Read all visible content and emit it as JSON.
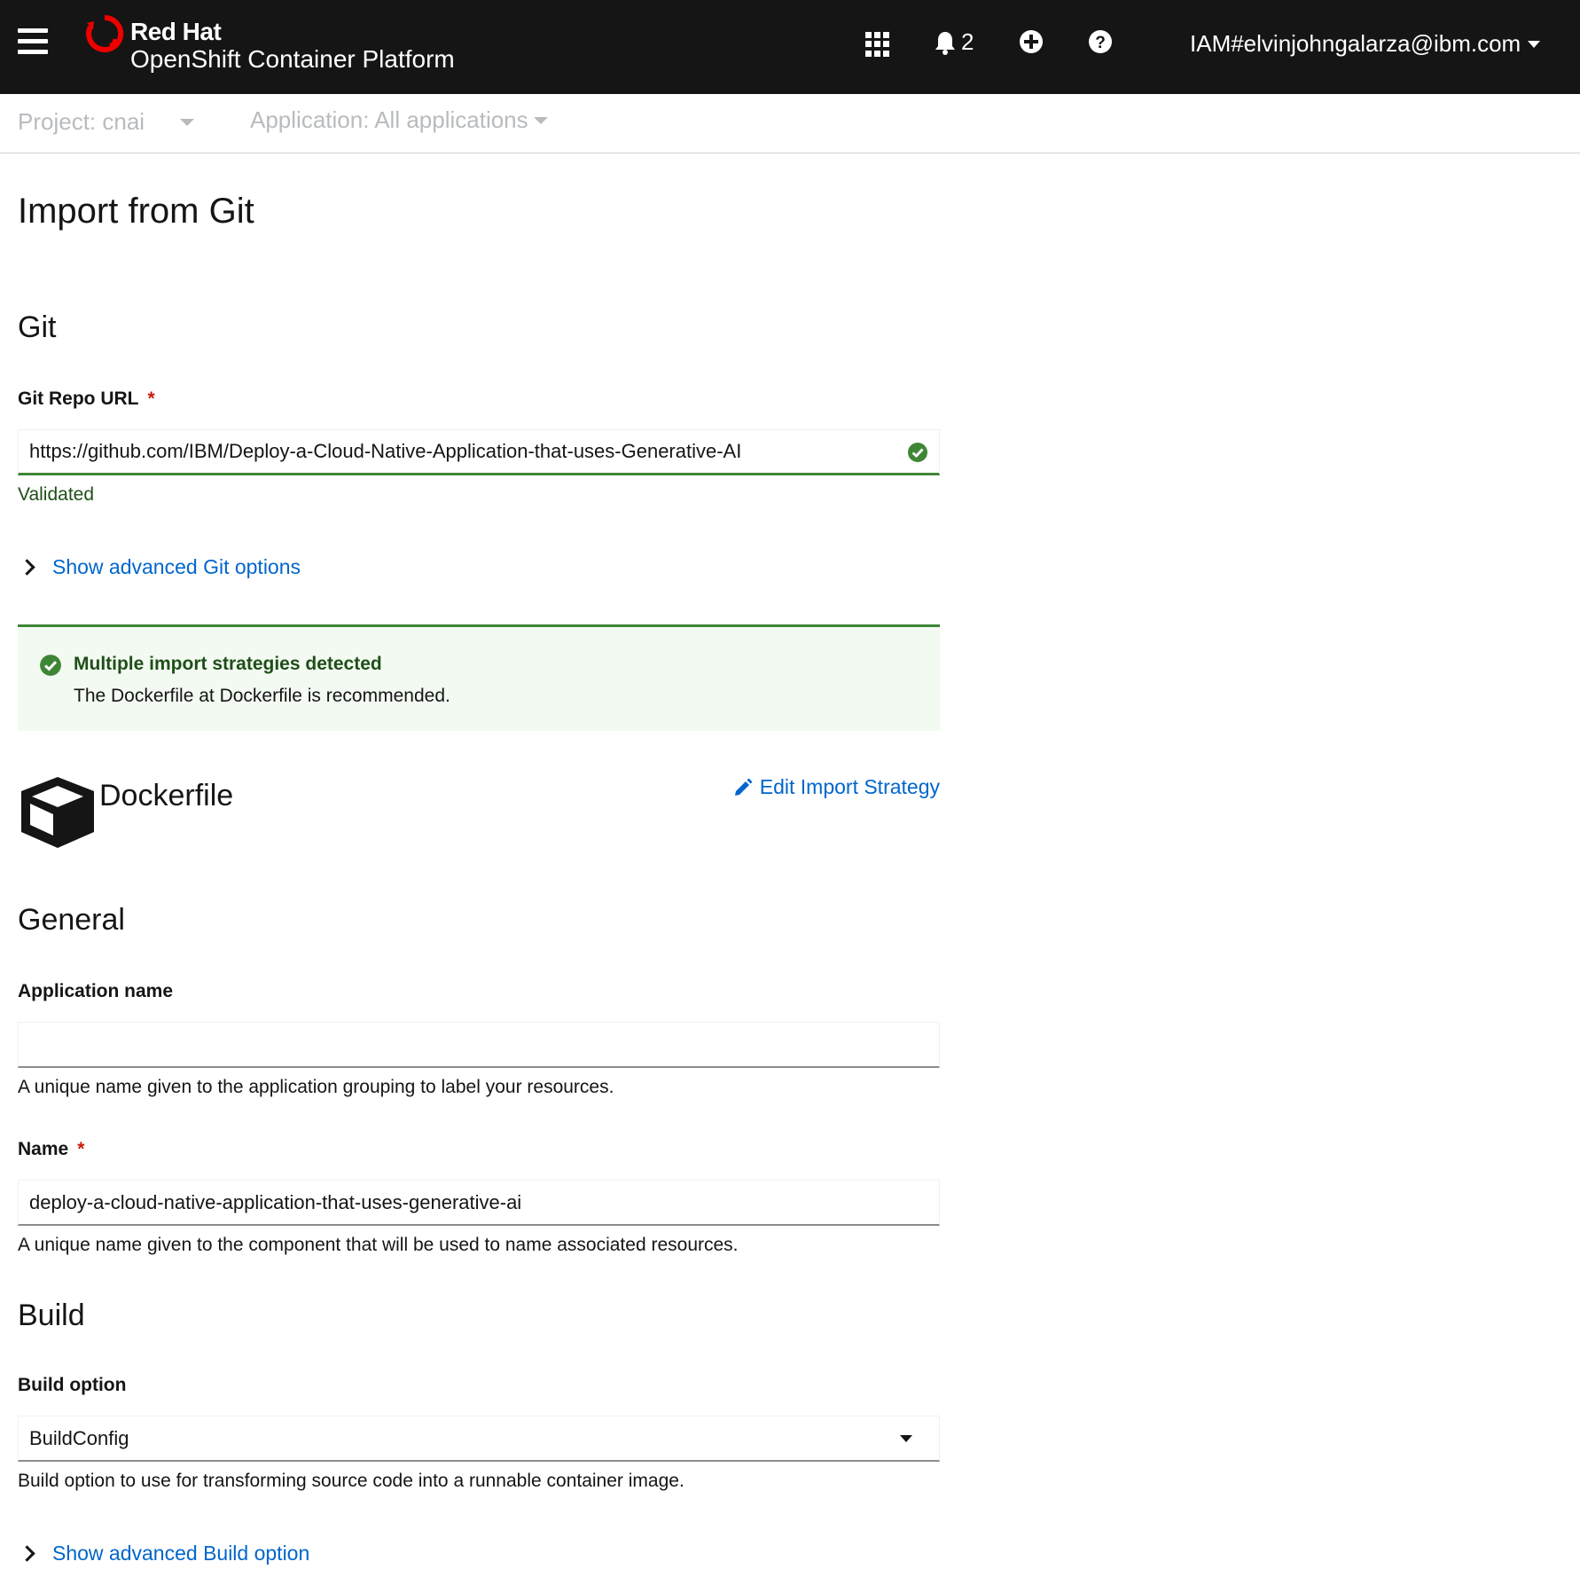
{
  "masthead": {
    "brand_top": "Red Hat",
    "brand_bottom": "OpenShift Container Platform",
    "notification_count": "2",
    "user": "IAM#elvinjohngalarza@ibm.com",
    "icons": [
      "hamburger-icon",
      "redhat-logo-icon",
      "app-launcher-icon",
      "bell-icon",
      "plus-circle-icon",
      "help-icon",
      "caret-down-icon"
    ]
  },
  "context": {
    "project": "Project: cnai",
    "application": "Application: All applications"
  },
  "page": {
    "title": "Import from Git"
  },
  "git": {
    "section_title": "Git",
    "repo_label": "Git Repo URL",
    "required_mark": "*",
    "repo_value": "https://github.com/IBM/Deploy-a-Cloud-Native-Application-that-uses-Generative-AI",
    "validation": "Validated",
    "advanced_link": "Show advanced Git options"
  },
  "alert": {
    "title": "Multiple import strategies detected",
    "body": "The Dockerfile at Dockerfile is recommended.",
    "status_color": "#3e8635"
  },
  "strategy": {
    "name": "Dockerfile",
    "edit_link": "Edit Import Strategy"
  },
  "general": {
    "section_title": "General",
    "app_name_label": "Application name",
    "app_name_value": "",
    "app_name_help": "A unique name given to the application grouping to label your resources.",
    "name_label": "Name",
    "required_mark": "*",
    "name_value": "deploy-a-cloud-native-application-that-uses-generative-ai",
    "name_help": "A unique name given to the component that will be used to name associated resources."
  },
  "build": {
    "section_title": "Build",
    "option_label": "Build option",
    "option_value": "BuildConfig",
    "option_help": "Build option to use for transforming source code into a runnable container image.",
    "advanced_link": "Show advanced Build option"
  }
}
